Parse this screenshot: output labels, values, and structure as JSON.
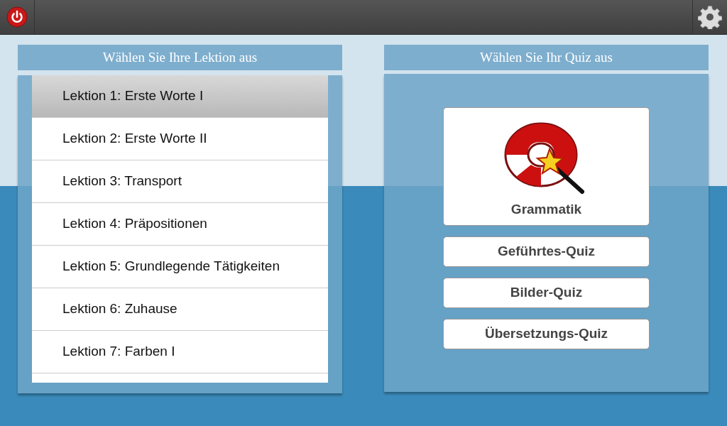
{
  "lessons_panel": {
    "title": "Wählen Sie Ihre Lektion aus",
    "lessons": [
      {
        "label": "Lektion 1: Erste Worte I",
        "selected": true
      },
      {
        "label": "Lektion 2: Erste Worte II",
        "selected": false
      },
      {
        "label": "Lektion 3: Transport",
        "selected": false
      },
      {
        "label": "Lektion 4: Präpositionen",
        "selected": false
      },
      {
        "label": "Lektion 5: Grundlegende Tätigkeiten",
        "selected": false
      },
      {
        "label": "Lektion 6: Zuhause",
        "selected": false
      },
      {
        "label": "Lektion 7: Farben I",
        "selected": false
      }
    ]
  },
  "quiz_panel": {
    "title": "Wählen Sie Ihr Quiz aus",
    "quizzes": [
      {
        "kind": "featured",
        "label": "Grammatik"
      },
      {
        "kind": "plain",
        "label": "Geführtes-Quiz"
      },
      {
        "kind": "plain",
        "label": "Bilder-Quiz"
      },
      {
        "kind": "plain",
        "label": "Übersetzungs-Quiz"
      }
    ]
  }
}
